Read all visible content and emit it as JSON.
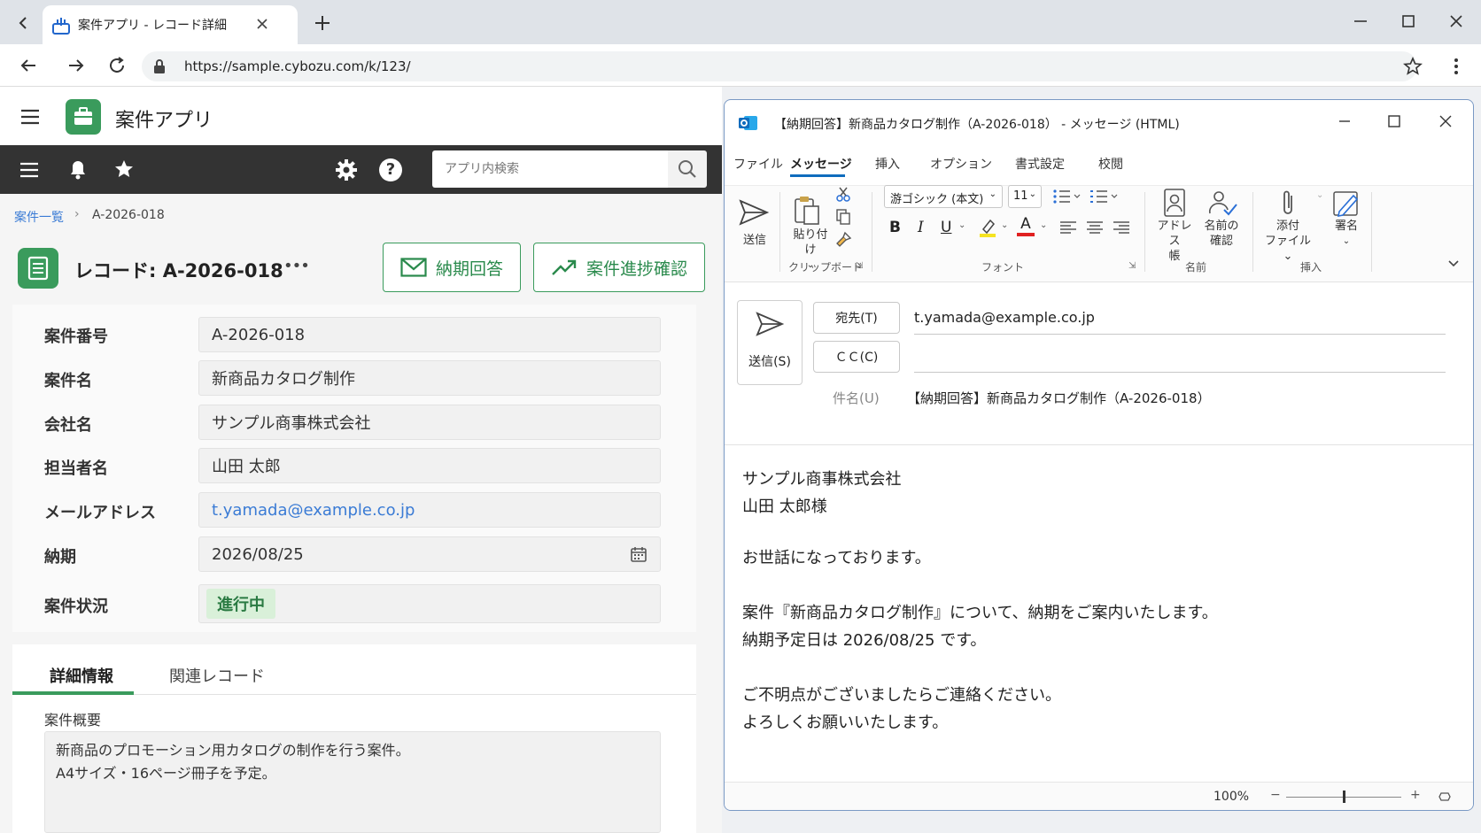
{
  "browser": {
    "tab_title": "案件アプリ - レコード詳細",
    "url": "https://sample.cybozu.com/k/123/"
  },
  "app": {
    "name": "案件アプリ",
    "search_placeholder": "アプリ内検索"
  },
  "breadcrumb": {
    "parent": "案件一覧",
    "current": "A-2026-018"
  },
  "record": {
    "title": "レコード: A-2026-018",
    "more": "•••",
    "buttons": {
      "reply": "納期回答",
      "progress": "案件進捗確認"
    },
    "fields": [
      {
        "label": "案件番号",
        "value": "A-2026-018"
      },
      {
        "label": "案件名",
        "value": "新商品カタログ制作"
      },
      {
        "label": "会社名",
        "value": "サンプル商事株式会社"
      },
      {
        "label": "担当者名",
        "value": "山田 太郎"
      },
      {
        "label": "メールアドレス",
        "value": "t.yamada@example.co.jp"
      },
      {
        "label": "納期",
        "value": "2026/08/25"
      },
      {
        "label": "案件状況",
        "value": "進行中"
      }
    ],
    "tabs": [
      "詳細情報",
      "関連レコード"
    ],
    "summary_label": "案件概要",
    "summary_lines": [
      "新商品のプロモーション用カタログの制作を行う案件。",
      "A4サイズ・16ページ冊子を予定。"
    ]
  },
  "outlook": {
    "window_title": "【納期回答】新商品カタログ制作（A-2026-018） - メッセージ (HTML)",
    "menu": [
      "ファイル",
      "メッセージ",
      "挿入",
      "オプション",
      "書式設定",
      "校閲"
    ],
    "ribbon": {
      "send": "送信",
      "paste": "貼り付け",
      "clipboard": "クリップボード",
      "font_name": "游ゴシック (本文)",
      "font_size": "11",
      "font_group": "フォント",
      "bold": "B",
      "italic": "I",
      "underline": "U",
      "font_color": "A",
      "address_book": [
        "アドレス",
        "帳"
      ],
      "check_names": [
        "名前の",
        "確認"
      ],
      "names_group": "名前",
      "attach": [
        "添付",
        "ファイル ⌄"
      ],
      "signature": "署名",
      "insert_group": "挿入"
    },
    "compose": {
      "send_button": "送信(S)",
      "to_button": "宛先(T)",
      "cc_button": "ＣＣ(C)",
      "to_value": "t.yamada@example.co.jp",
      "cc_value": "",
      "subject_label": "件名(U)",
      "subject_value": "【納期回答】新商品カタログ制作（A-2026-018）"
    },
    "body": [
      "サンプル商事株式会社",
      "山田 太郎様",
      "お世話になっております。",
      "案件『新商品カタログ制作』について、納期をご案内いたします。",
      "納期予定日は 2026/08/25 です。",
      "ご不明点がございましたらご連絡ください。",
      "よろしくお願いいたします。"
    ],
    "zoom": "100%",
    "zoom_level": 0.5
  },
  "colors": {
    "kintone_green": "#3a9b5c",
    "status_bg": "#d9f0d9",
    "outlook_blue": "#0f6cbd"
  }
}
